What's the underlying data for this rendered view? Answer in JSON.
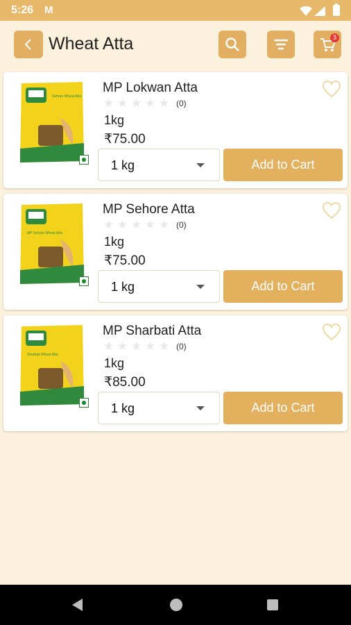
{
  "status_bar": {
    "time": "5:26",
    "mail_icon": "gmail-icon"
  },
  "header": {
    "title": "Wheat Atta",
    "back_icon": "chevron-left-icon",
    "search_icon": "search-icon",
    "filter_icon": "filter-icon",
    "cart_icon": "cart-icon",
    "cart_count": "3"
  },
  "products": [
    {
      "name": "MP Lokwan Atta",
      "rating_count": "(0)",
      "weight": "1kg",
      "price": "₹75.00",
      "qty": "1 kg",
      "cta": "Add to Cart",
      "pack_label": "Sehore Wheat Atta"
    },
    {
      "name": "MP Sehore Atta",
      "rating_count": "(0)",
      "weight": "1kg",
      "price": "₹75.00",
      "qty": "1 kg",
      "cta": "Add to Cart",
      "pack_label": "MP Sehore Wheat Atta"
    },
    {
      "name": "MP Sharbati Atta",
      "rating_count": "(0)",
      "weight": "1kg",
      "price": "₹85.00",
      "qty": "1 kg",
      "cta": "Add to Cart",
      "pack_label": "Sharbati Wheat Atta"
    }
  ],
  "colors": {
    "accent": "#e3b15e",
    "status_bar": "#e8b96a",
    "background": "#fbf1dc",
    "veg": "#1b8a2e",
    "badge": "#e53935"
  }
}
